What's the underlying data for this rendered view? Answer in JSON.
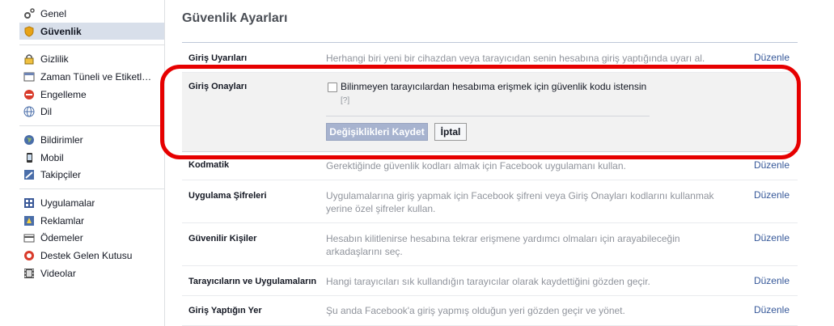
{
  "sidebar": {
    "groups": [
      [
        {
          "label": "Genel",
          "icon": "gear-icon"
        },
        {
          "label": "Güvenlik",
          "icon": "shield-icon",
          "selected": true
        }
      ],
      [
        {
          "label": "Gizlilik",
          "icon": "lock-icon"
        },
        {
          "label": "Zaman Tüneli ve Etiketl…",
          "icon": "timeline-icon"
        },
        {
          "label": "Engelleme",
          "icon": "block-icon"
        },
        {
          "label": "Dil",
          "icon": "globe-icon"
        }
      ],
      [
        {
          "label": "Bildirimler",
          "icon": "notification-globe-icon"
        },
        {
          "label": "Mobil",
          "icon": "mobile-icon"
        },
        {
          "label": "Takipçiler",
          "icon": "rss-icon"
        }
      ],
      [
        {
          "label": "Uygulamalar",
          "icon": "apps-icon"
        },
        {
          "label": "Reklamlar",
          "icon": "ads-icon"
        },
        {
          "label": "Ödemeler",
          "icon": "payment-icon"
        },
        {
          "label": "Destek Gelen Kutusu",
          "icon": "support-icon"
        },
        {
          "label": "Videolar",
          "icon": "video-icon"
        }
      ]
    ]
  },
  "main": {
    "title": "Güvenlik Ayarları",
    "edit_label": "Düzenle",
    "rows": {
      "login_alerts": {
        "label": "Giriş Uyarıları",
        "desc": "Herhangi biri yeni bir cihazdan veya tarayıcıdan senin hesabına giriş yaptığında uyarı al."
      },
      "code_generator": {
        "label": "Kodmatik",
        "desc": "Gerektiğinde güvenlik kodları almak için Facebook uygulamanı kullan."
      },
      "app_passwords": {
        "label": "Uygulama Şifreleri",
        "desc": "Uygulamalarına giriş yapmak için Facebook şifreni veya Giriş Onayları kodlarını kullanmak yerine özel şifreler kullan."
      },
      "trusted_contacts": {
        "label": "Güvenilir Kişiler",
        "desc": "Hesabın kilitlenirse hesabına tekrar erişmene yardımcı olmaları için arayabileceğin arkadaşlarını seç."
      },
      "browsers_apps": {
        "label": "Tarayıcıların ve Uygulamaların",
        "desc": "Hangi tarayıcıları sık kullandığın tarayıcılar olarak kaydettiğini gözden geçir."
      },
      "where_logged_in": {
        "label": "Giriş Yaptığın Yer",
        "desc": "Şu anda Facebook'a giriş yapmış olduğun yeri gözden geçir ve yönet."
      }
    },
    "login_approvals": {
      "label": "Giriş Onayları",
      "checkbox_text": "Bilinmeyen tarayıcılardan hesabıma erişmek için güvenlik kodu istensin",
      "help": "[?]",
      "save_label": "Değişiklikleri Kaydet",
      "cancel_label": "İptal"
    }
  },
  "colors": {
    "annotation": "#e60000",
    "link": "#365899",
    "selected_bg": "#d8dfea"
  }
}
